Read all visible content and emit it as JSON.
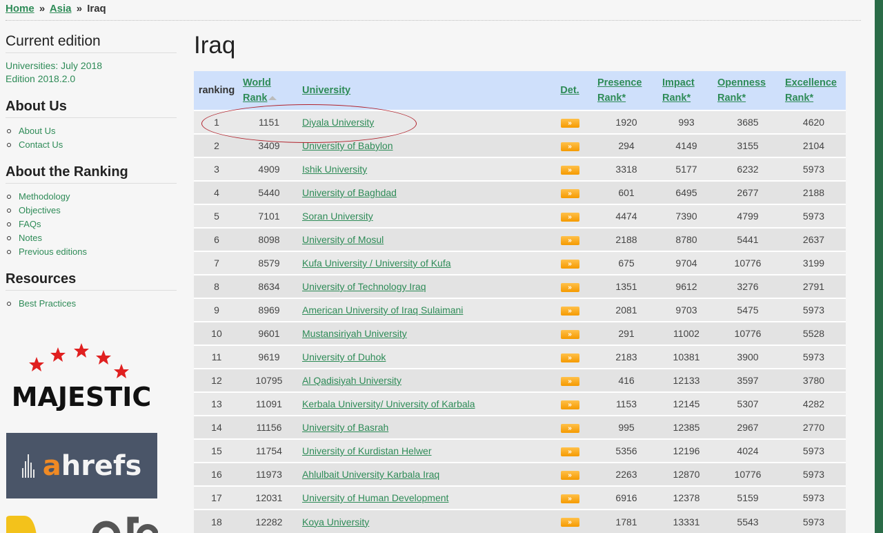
{
  "breadcrumb": {
    "home": "Home",
    "asia": "Asia",
    "current": "Iraq",
    "sep": "»"
  },
  "sidebar": {
    "current_edition_heading": "Current edition",
    "edition_line1": "Universities: July 2018",
    "edition_line2": "Edition 2018.2.0",
    "about_us_heading": "About Us",
    "about_us_items": [
      "About Us",
      "Contact Us"
    ],
    "about_ranking_heading": "About the Ranking",
    "about_ranking_items": [
      "Methodology",
      "Objectives",
      "FAQs",
      "Notes",
      "Previous editions"
    ],
    "resources_heading": "Resources",
    "resources_items": [
      "Best Practices"
    ],
    "logos": {
      "majestic": "MAJESTIC",
      "ahrefs_a": "a",
      "ahrefs_rest": "hrefs"
    }
  },
  "main": {
    "title": "Iraq",
    "headers": {
      "ranking": "ranking",
      "world_rank_1": "World",
      "world_rank_2": "Rank",
      "university": "University",
      "det": "Det.",
      "presence_1": "Presence",
      "presence_2": "Rank*",
      "impact_1": "Impact",
      "impact_2": "Rank*",
      "openness_1": "Openness",
      "openness_2": "Rank*",
      "excellence_1": "Excellence",
      "excellence_2": "Rank*"
    },
    "det_label": "»",
    "rows": [
      {
        "ranking": "1",
        "world": "1151",
        "university": "Diyala University",
        "presence": "1920",
        "impact": "993",
        "openness": "3685",
        "excellence": "4620"
      },
      {
        "ranking": "2",
        "world": "3409",
        "university": "University of Babylon",
        "presence": "294",
        "impact": "4149",
        "openness": "3155",
        "excellence": "2104"
      },
      {
        "ranking": "3",
        "world": "4909",
        "university": "Ishik University",
        "presence": "3318",
        "impact": "5177",
        "openness": "6232",
        "excellence": "5973"
      },
      {
        "ranking": "4",
        "world": "5440",
        "university": "University of Baghdad",
        "presence": "601",
        "impact": "6495",
        "openness": "2677",
        "excellence": "2188"
      },
      {
        "ranking": "5",
        "world": "7101",
        "university": "Soran University",
        "presence": "4474",
        "impact": "7390",
        "openness": "4799",
        "excellence": "5973"
      },
      {
        "ranking": "6",
        "world": "8098",
        "university": "University of Mosul",
        "presence": "2188",
        "impact": "8780",
        "openness": "5441",
        "excellence": "2637"
      },
      {
        "ranking": "7",
        "world": "8579",
        "university": "Kufa University / University of Kufa",
        "presence": "675",
        "impact": "9704",
        "openness": "10776",
        "excellence": "3199"
      },
      {
        "ranking": "8",
        "world": "8634",
        "university": "University of Technology Iraq",
        "presence": "1351",
        "impact": "9612",
        "openness": "3276",
        "excellence": "2791"
      },
      {
        "ranking": "9",
        "world": "8969",
        "university": "American University of Iraq Sulaimani",
        "presence": "2081",
        "impact": "9703",
        "openness": "5475",
        "excellence": "5973"
      },
      {
        "ranking": "10",
        "world": "9601",
        "university": "Mustansiriyah University",
        "presence": "291",
        "impact": "11002",
        "openness": "10776",
        "excellence": "5528"
      },
      {
        "ranking": "11",
        "world": "9619",
        "university": "University of Duhok",
        "presence": "2183",
        "impact": "10381",
        "openness": "3900",
        "excellence": "5973"
      },
      {
        "ranking": "12",
        "world": "10795",
        "university": "Al Qadisiyah University",
        "presence": "416",
        "impact": "12133",
        "openness": "3597",
        "excellence": "3780"
      },
      {
        "ranking": "13",
        "world": "11091",
        "university": "Kerbala University/ University of Karbala",
        "presence": "1153",
        "impact": "12145",
        "openness": "5307",
        "excellence": "4282"
      },
      {
        "ranking": "14",
        "world": "11156",
        "university": "University of Basrah",
        "presence": "995",
        "impact": "12385",
        "openness": "2967",
        "excellence": "2770"
      },
      {
        "ranking": "15",
        "world": "11754",
        "university": "University of Kurdistan Helwer",
        "presence": "5356",
        "impact": "12196",
        "openness": "4024",
        "excellence": "5973"
      },
      {
        "ranking": "16",
        "world": "11973",
        "university": "Ahlulbait University Karbala Iraq",
        "presence": "2263",
        "impact": "12870",
        "openness": "10776",
        "excellence": "5973"
      },
      {
        "ranking": "17",
        "world": "12031",
        "university": "University of Human Development",
        "presence": "6916",
        "impact": "12378",
        "openness": "5159",
        "excellence": "5973"
      },
      {
        "ranking": "18",
        "world": "12282",
        "university": "Koya University",
        "presence": "1781",
        "impact": "13331",
        "openness": "5543",
        "excellence": "5973"
      }
    ]
  },
  "colors": {
    "link": "#2e8b57",
    "header_bg": "#cfe0fb",
    "det_button": "#f59a00",
    "highlight": "#b0202a",
    "right_bar": "#2a6b47"
  }
}
